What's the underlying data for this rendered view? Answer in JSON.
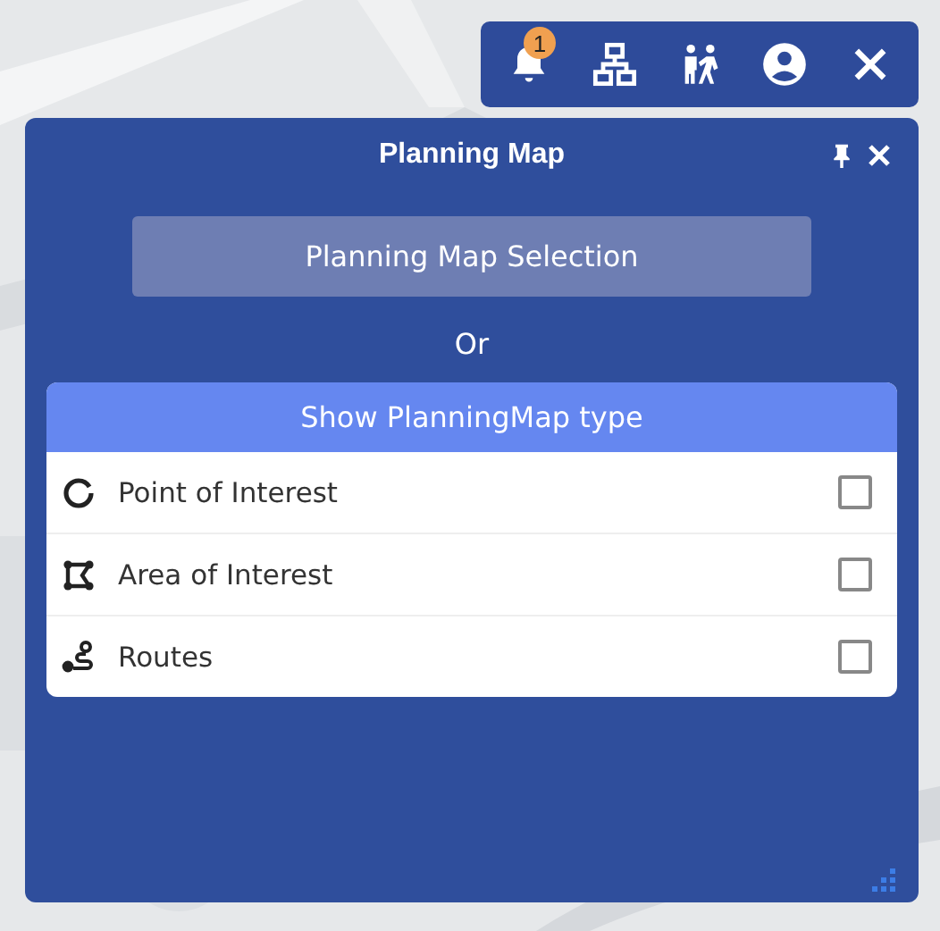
{
  "toolbar": {
    "buttons": [
      {
        "kind": "bell",
        "badge": "1"
      },
      {
        "kind": "network"
      },
      {
        "kind": "people"
      },
      {
        "kind": "account"
      },
      {
        "kind": "close"
      }
    ]
  },
  "panel": {
    "title": "Planning Map",
    "selection_button": "Planning Map Selection",
    "separator": "Or",
    "section_header": "Show PlanningMap type",
    "items": [
      {
        "kind": "point",
        "label": "Point of Interest",
        "checked": false
      },
      {
        "kind": "area",
        "label": "Area of Interest",
        "checked": false
      },
      {
        "kind": "route",
        "label": "Routes",
        "checked": false
      }
    ]
  }
}
